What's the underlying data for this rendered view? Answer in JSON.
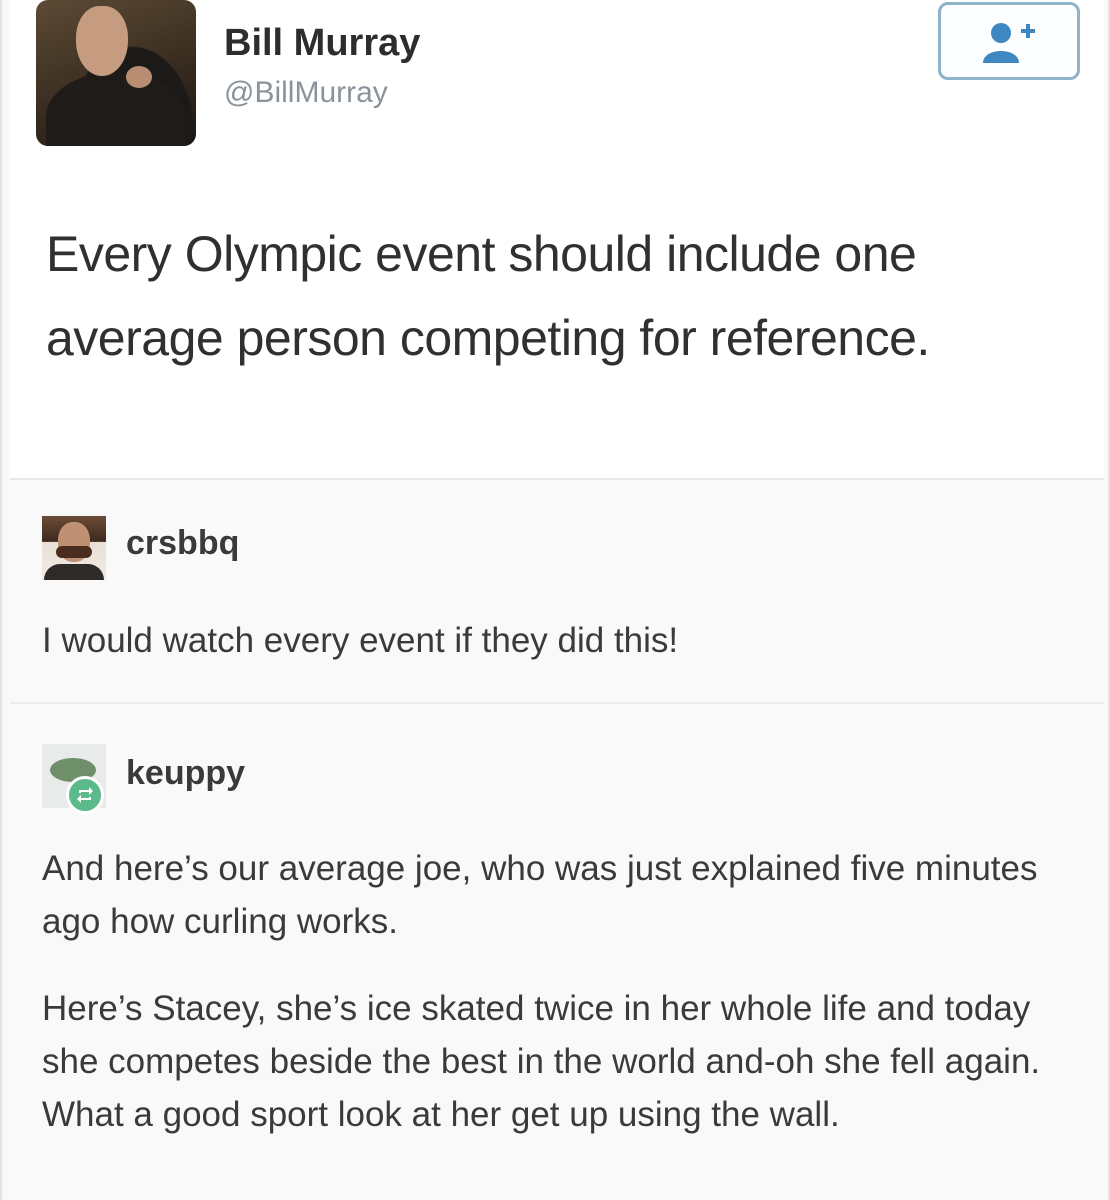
{
  "tweet": {
    "display_name": "Bill Murray",
    "handle": "@BillMurray",
    "text": "Every Olympic event should include one average person competing for reference.",
    "follow_icon": "add-user-icon"
  },
  "replies": [
    {
      "username": "crsbbq",
      "paragraphs": [
        "I would watch every event if they did this!"
      ]
    },
    {
      "username": "keuppy",
      "badge_icon": "reblog-icon",
      "paragraphs": [
        "And here’s our average joe, who was just explained five minutes ago how curling works.",
        "Here’s Stacey, she’s ice skated twice in her whole life and today she competes beside the best in the world and-oh she fell again. What a good sport look at her get up using the wall."
      ]
    }
  ],
  "colors": {
    "follow_border": "#8fb3c8",
    "follow_icon": "#3d88c2",
    "reblog_badge": "#5cb98a",
    "handle": "#8a939c"
  }
}
